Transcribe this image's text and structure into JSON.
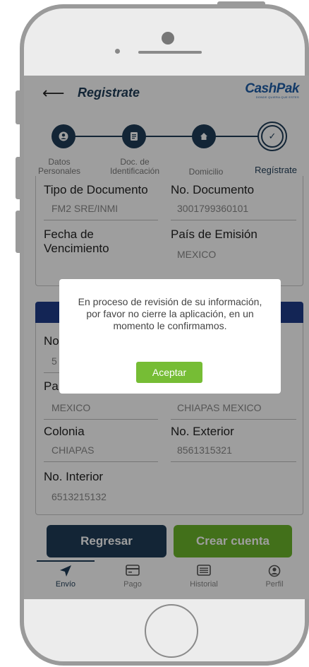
{
  "header": {
    "back_icon": "arrow-left-icon",
    "title": "Registrate",
    "logo_text": "CashPak",
    "logo_tagline": "DONDE QUIERA QUE ESTES"
  },
  "stepper": {
    "steps": [
      {
        "label_line1": "Datos",
        "label_line2": "Personales",
        "icon": "person-icon",
        "state": "done"
      },
      {
        "label_line1": "Doc. de",
        "label_line2": "Identificación",
        "icon": "document-icon",
        "state": "done"
      },
      {
        "label_line1": "Domicilio",
        "label_line2": "",
        "icon": "home-icon",
        "state": "done"
      },
      {
        "label_line1": "Regístrate",
        "label_line2": "",
        "icon": "check-icon",
        "state": "current"
      }
    ]
  },
  "document_card": {
    "doc_type_label": "Tipo de Documento",
    "doc_type_value": "FM2 SRE/INMI",
    "doc_number_label": "No. Documento",
    "doc_number_value": "3001799360101",
    "expiry_label_line1": "Fecha de",
    "expiry_label_line2": "Vencimiento",
    "country_label": "País de Emisión",
    "country_value": "MEXICO"
  },
  "address_card": {
    "field1_label_partial": "No",
    "field1_value_partial": "5",
    "field2_label_partial": "Pa",
    "country_value": "MEXICO",
    "state_value": "CHIAPAS MEXICO",
    "colonia_label": "Colonia",
    "colonia_value": "CHIAPAS",
    "ext_label": "No. Exterior",
    "ext_value": "8561315321",
    "int_label": "No. Interior",
    "int_value": "6513215132"
  },
  "buttons": {
    "back": "Regresar",
    "create": "Crear cuenta"
  },
  "tabbar": {
    "tabs": [
      {
        "label": "Envío",
        "icon": "send-icon",
        "active": true
      },
      {
        "label": "Pago",
        "icon": "card-icon",
        "active": false
      },
      {
        "label": "Historial",
        "icon": "list-icon",
        "active": false
      },
      {
        "label": "Perfil",
        "icon": "user-icon",
        "active": false
      }
    ]
  },
  "modal": {
    "message": "En proceso de revisión de su información, por favor no cierre la aplicación, en un momento le confirmamos.",
    "accept": "Aceptar"
  },
  "colors": {
    "primary": "#1f3d57",
    "accent_green": "#6bb52b",
    "logo_blue": "#1f5ea8"
  }
}
